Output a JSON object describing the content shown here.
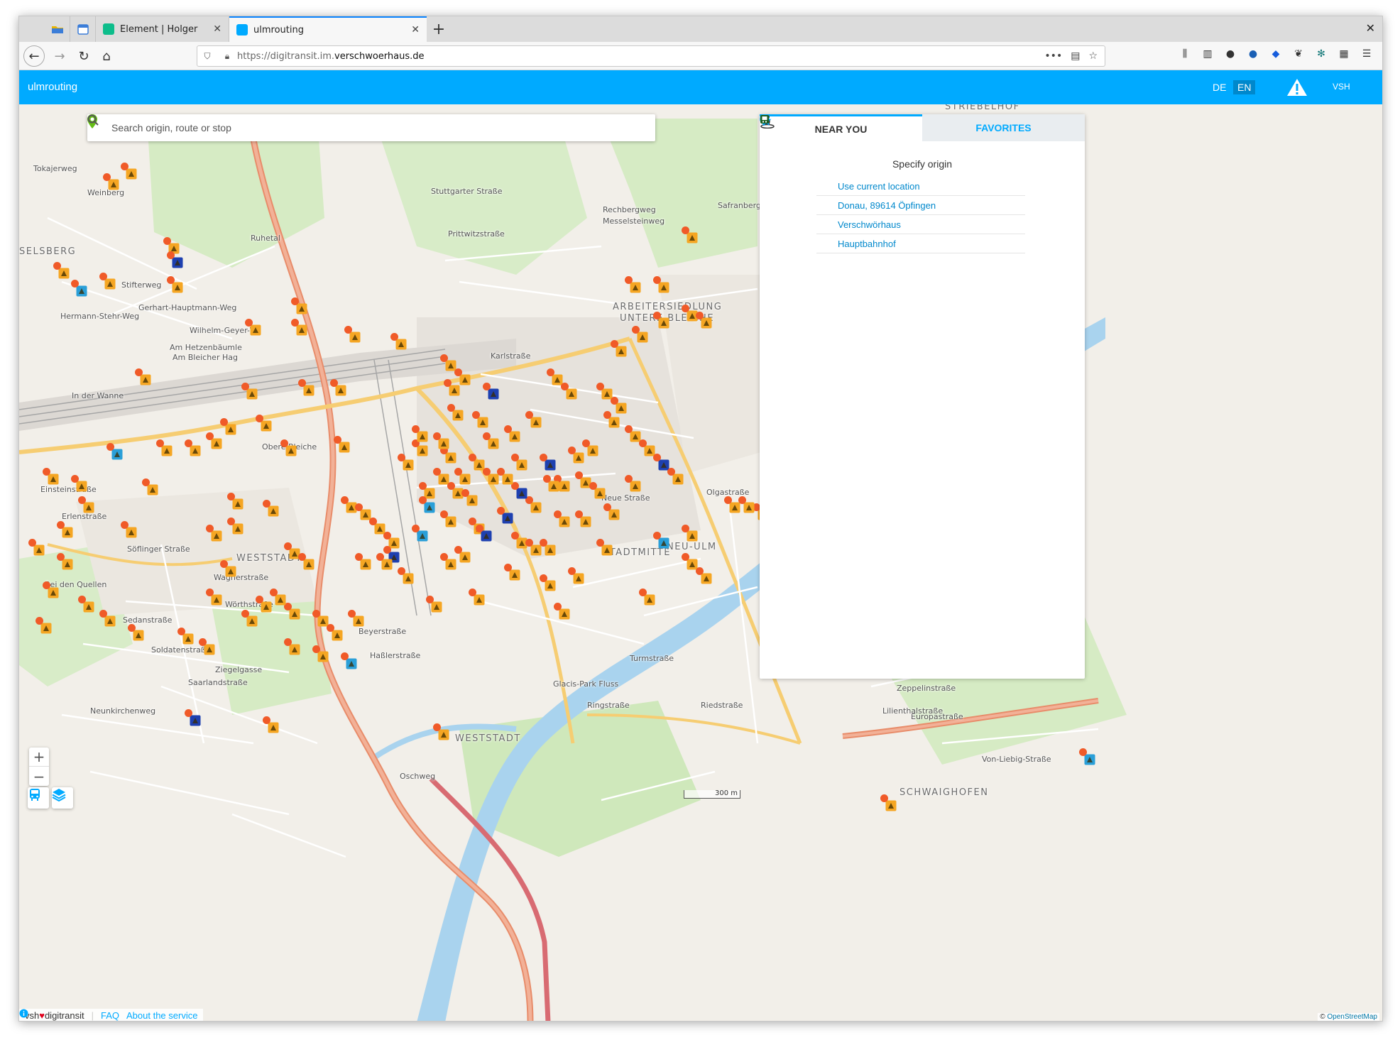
{
  "browser": {
    "tabs": [
      {
        "label": "Element | Holger",
        "active": false
      },
      {
        "label": "ulmrouting",
        "active": true
      }
    ],
    "url_prefix": "https://digitransit.im.",
    "url_domain": "verschwoerhaus.de"
  },
  "app": {
    "title": "ulmrouting",
    "lang_de": "DE",
    "lang_en": "EN",
    "account": "VSH",
    "accent_color": "#00aaff"
  },
  "search": {
    "placeholder": "Search origin, route or stop"
  },
  "panel": {
    "tab_near": "NEAR YOU",
    "tab_favorites": "FAVORITES",
    "heading": "Specify origin",
    "options": [
      {
        "icon": "locate-icon",
        "label": "Use current location"
      },
      {
        "icon": "map-pin-icon",
        "label": "Donau, 89614 Öpfingen"
      },
      {
        "icon": "star-icon",
        "label": "Verschwörhaus"
      },
      {
        "icon": "station-icon",
        "label": "Hauptbahnhof"
      }
    ]
  },
  "map": {
    "labels": [
      "Tokajerweg",
      "Weinberg",
      "SELSBERG",
      "Stifterweg",
      "Hermann-Stehr-Weg",
      "Gerhart-Hauptmann-Weg",
      "Wilhelm-Geyer-W",
      "Am Hetzenbäumle",
      "Am Bleicher Hag",
      "In der Wanne",
      "Obere Bleiche",
      "Einsteinstraße",
      "Erlenstraße",
      "Söflinger Straße",
      "WESTSTADT",
      "Wagnerstraße",
      "Bei den Quellen",
      "Wörthstraße",
      "Sedanstraße",
      "Soldatenstraße",
      "Ziegelgasse",
      "Saarlandstraße",
      "Neunkirchenweg",
      "Stuttgarter Straße",
      "Prittwitzstraße",
      "Karlstraße",
      "ARBEITERSIEDLUNG",
      "UNTERE BLEICHE",
      "Neue Straße",
      "STADTMITTE",
      "NEU-ULM",
      "Turmstraße",
      "Ringstraße",
      "Riedstraße",
      "Europastraße",
      "Zeppelinstraße",
      "Lilienthalstraße",
      "Von-Liebig-Straße",
      "SCHWAIGHOFEN",
      "WESTSTADT",
      "Oschweg",
      "Beyerstraße",
      "Haßlerstraße",
      "Glacis-Park Fluss",
      "Safranberg",
      "Rechbergweg",
      "Messelsteinweg",
      "STRIEBELHOF",
      "Olgastraße",
      "Ruhetal"
    ],
    "scale_label": "300 m",
    "attribution_prefix": "©",
    "attribution_link": "OpenStreetMap"
  },
  "footer": {
    "brand_left": "vsh",
    "brand_right": "digitransit",
    "faq": "FAQ",
    "about": "About the service"
  }
}
